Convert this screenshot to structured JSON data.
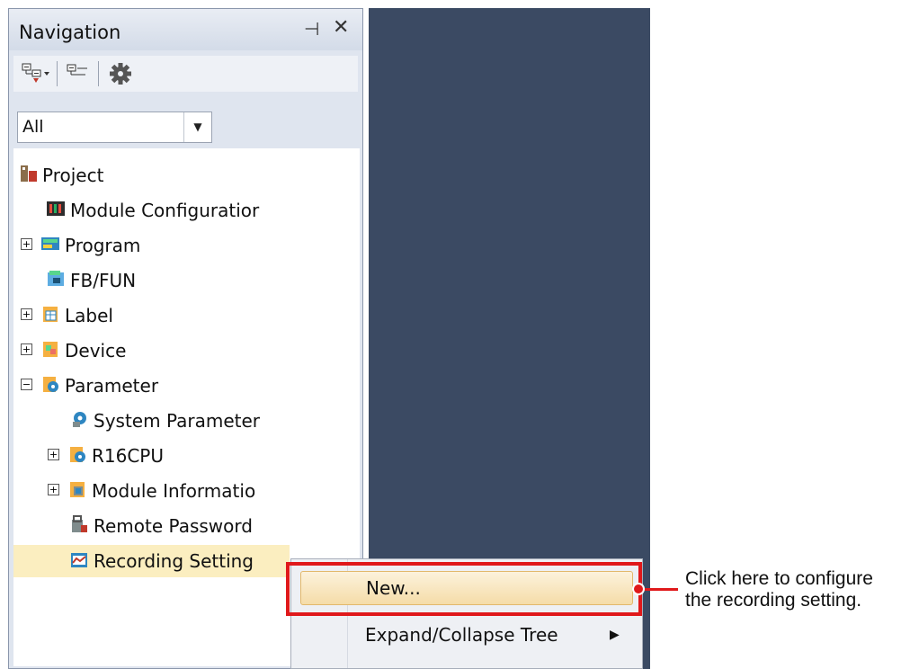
{
  "panel": {
    "title": "Navigation",
    "pin_glyph": "⊣",
    "close_glyph": "✕"
  },
  "toolbar": {
    "buttons": [
      {
        "icon": "expand-tree-icon"
      },
      {
        "icon": "collapse-tree-icon"
      },
      {
        "icon": "gear-icon"
      }
    ]
  },
  "filter": {
    "value": "All"
  },
  "tree": {
    "items": [
      {
        "label": "Project",
        "expander": "",
        "icon": "project-icon"
      },
      {
        "label": "Module Configuratior",
        "expander": "",
        "icon": "module-configuration-icon"
      },
      {
        "label": "Program",
        "expander": "+",
        "icon": "program-icon"
      },
      {
        "label": "FB/FUN",
        "expander": "",
        "icon": "fb-fun-icon"
      },
      {
        "label": "Label",
        "expander": "+",
        "icon": "label-icon"
      },
      {
        "label": "Device",
        "expander": "+",
        "icon": "device-icon"
      },
      {
        "label": "Parameter",
        "expander": "−",
        "icon": "parameter-icon"
      },
      {
        "label": "System Parameter",
        "expander": "",
        "icon": "system-parameter-icon"
      },
      {
        "label": "R16CPU",
        "expander": "+",
        "icon": "cpu-icon"
      },
      {
        "label": "Module Informatio",
        "expander": "+",
        "icon": "module-information-icon"
      },
      {
        "label": "Remote Password",
        "expander": "",
        "icon": "remote-password-icon"
      },
      {
        "label": "Recording Setting",
        "expander": "",
        "icon": "recording-setting-icon"
      }
    ]
  },
  "context_menu": {
    "items": [
      {
        "label": "New..."
      },
      {
        "label": "Expand/Collapse Tree",
        "submenu_arrow": "▶"
      }
    ]
  },
  "callout": {
    "line1": "Click here to configure",
    "line2": "the recording setting.",
    "color": "#e0191b"
  }
}
